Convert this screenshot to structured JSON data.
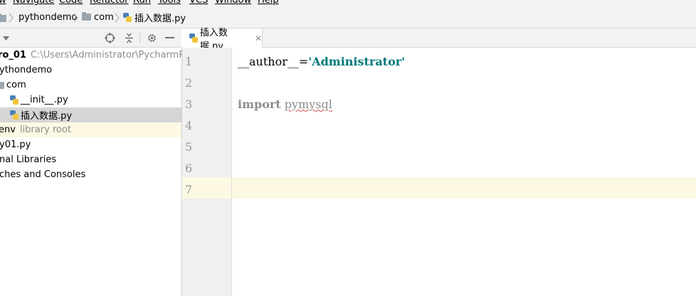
{
  "menu": [
    "w",
    "Navigate",
    "Code",
    "Refactor",
    "Run",
    "Tools",
    "VCS",
    "Window",
    "Help"
  ],
  "breadcrumb": [
    "pythondemo",
    "com",
    "插入数据.py"
  ],
  "tree": {
    "root_name": "ro_01",
    "root_path": "C:\\Users\\Administrator\\PycharmProjec",
    "pkg": "ythondemo",
    "com": "com",
    "init": "__init__.py",
    "insert": "插入数据.py",
    "venv": "env",
    "venv_hint": "library root",
    "py01": "y01.py",
    "ext": "nal Libraries",
    "scratches": "ches and Consoles"
  },
  "tab": {
    "label": "插入数据.py"
  },
  "lines": [
    "1",
    "2",
    "3",
    "4",
    "5",
    "6",
    "7"
  ],
  "code": {
    "author_var": "__author__",
    "eq": "=",
    "author_val": "'Administrator'",
    "import_kw": "import",
    "module": "pymysql"
  }
}
